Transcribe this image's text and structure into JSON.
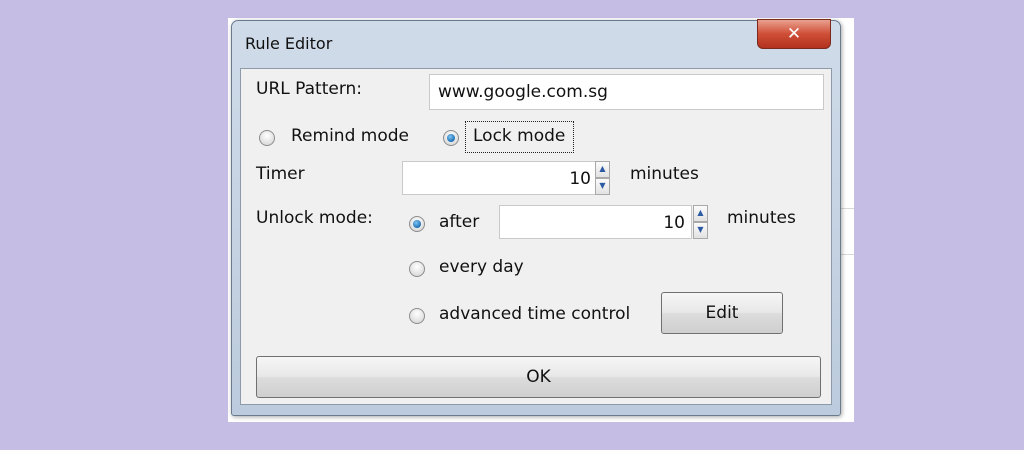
{
  "dialog": {
    "title": "Rule Editor",
    "close_symbol": "✕",
    "url_pattern_label": "URL Pattern:",
    "url_pattern_value": "www.google.com.sg",
    "mode_remind_label": "Remind mode",
    "mode_lock_label": "Lock mode",
    "selected_mode": "Lock mode",
    "timer_label": "Timer",
    "timer_value": "10",
    "timer_unit": "minutes",
    "unlock_mode_label": "Unlock mode:",
    "unlock_after_label": "after",
    "unlock_after_value": "10",
    "unlock_after_unit": "minutes",
    "unlock_every_day_label": "every day",
    "unlock_advanced_label": "advanced time control",
    "selected_unlock": "after",
    "edit_button_label": "Edit",
    "ok_button_label": "OK",
    "icons": {
      "close": "close-icon",
      "spin_up": "spin-up-icon",
      "spin_down": "spin-down-icon"
    }
  }
}
